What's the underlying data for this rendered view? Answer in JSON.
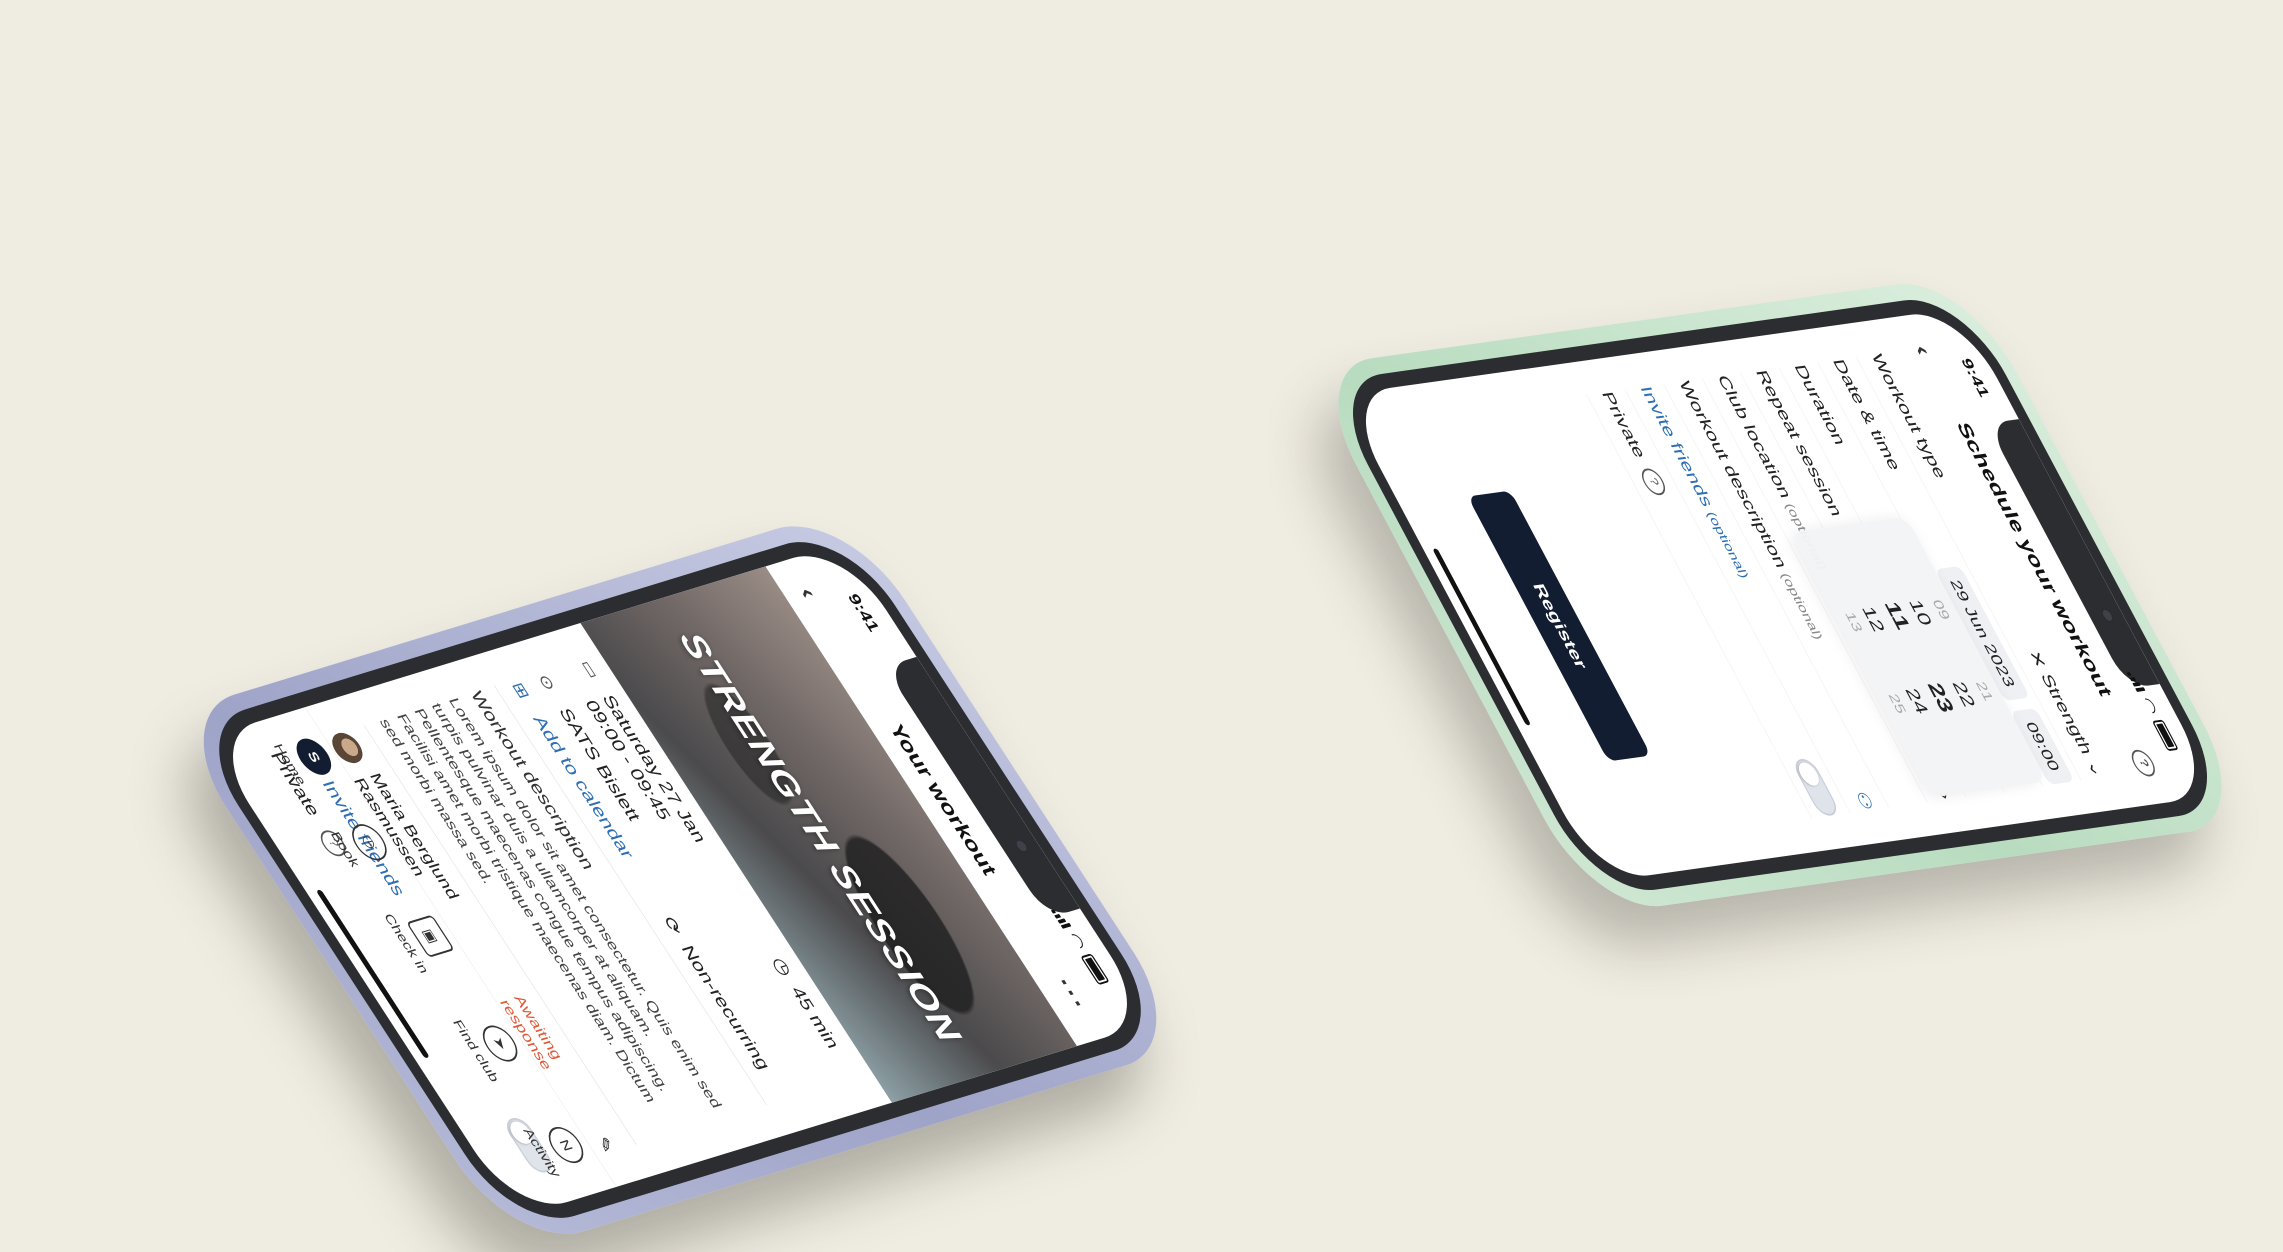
{
  "left_phone": {
    "status_time": "9:41",
    "title": "Your workout",
    "hero_title": "STRENGTH SESSION",
    "date": "Saturday 27 Jan",
    "time_range": "09:00 - 09:45",
    "location": "SATS Bislett",
    "add_to_calendar": "Add to calendar",
    "duration": "45 min",
    "recurrence": "Non-recurring",
    "description_title": "Workout description",
    "description_text": "Lorem ipsum dolor sit amet consectetur. Quis enim sed turpis pulvinar duis a ullamcorper at aliquam. Pellentesque maecenas congue tempus adipiscing. Facilisi amet morbi tristique maecenas diam. Dictum sed morbi massa sed.",
    "participant_name": "Maria Berglund Rasmussen",
    "participant_status": "Awaiting response",
    "invite_friends": "Invite friends",
    "private_label": "Private",
    "tabs": [
      {
        "label": "Home",
        "icon": "S"
      },
      {
        "label": "Book",
        "icon": "◷"
      },
      {
        "label": "Check in",
        "icon": "▣"
      },
      {
        "label": "Find club",
        "icon": "➤"
      },
      {
        "label": "Activity",
        "icon": "N"
      }
    ],
    "colors": {
      "accent": "#2f6fb4",
      "warning": "#e05a3a",
      "nav": "#121d31"
    }
  },
  "right_phone": {
    "status_time": "9:41",
    "title": "Schedule your workout",
    "workout_type_label": "Workout type",
    "workout_type_value": "Strength",
    "date_time_label": "Date & time",
    "date_value": "29 Jun 2023",
    "time_value": "09:00",
    "duration_label": "Duration",
    "repeat_label": "Repeat session",
    "club_location_label": "Club location",
    "optional": "(optional)",
    "workout_description_label": "Workout description",
    "invite_friends": "Invite friends",
    "private_label": "Private",
    "picker_hours": [
      "09",
      "10",
      "11",
      "12",
      "13"
    ],
    "picker_minutes": [
      "21",
      "22",
      "23",
      "24",
      "25"
    ],
    "register": "Register"
  }
}
